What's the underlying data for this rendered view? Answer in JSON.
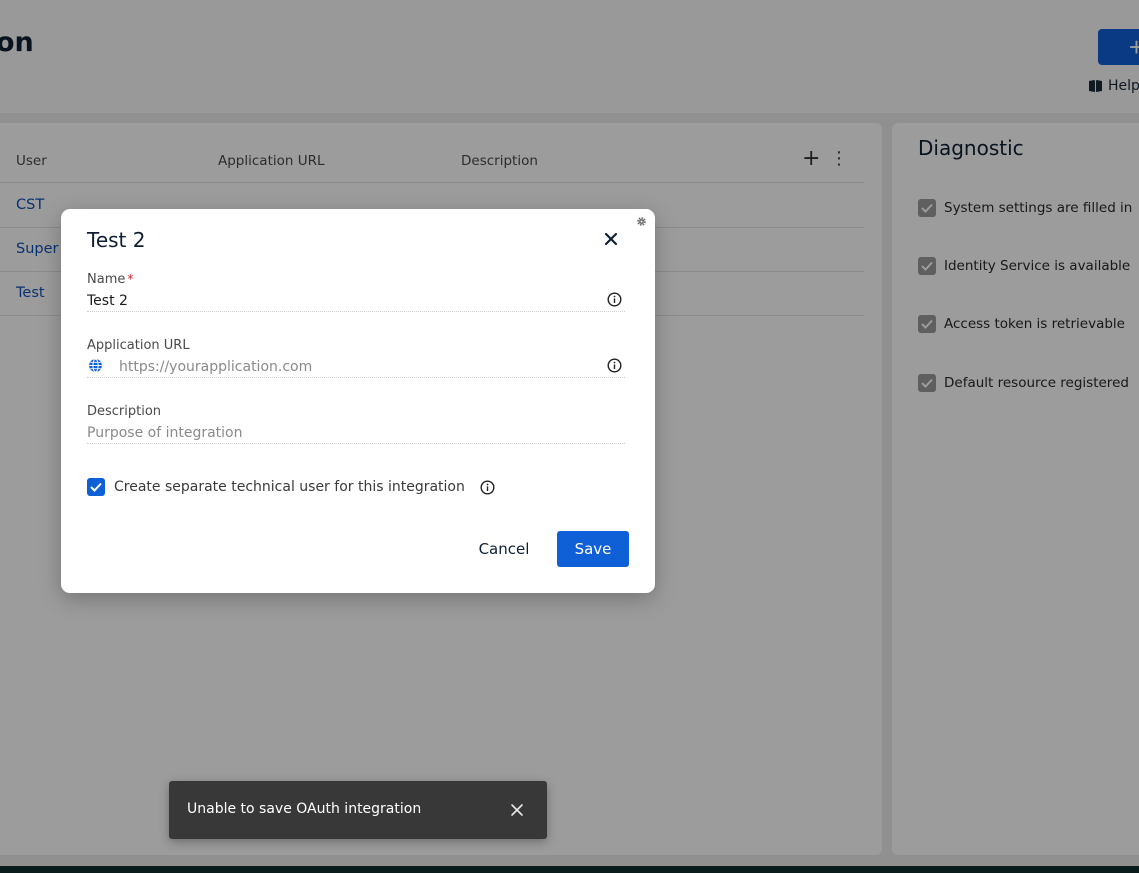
{
  "page": {
    "title": "on",
    "add_label": "+",
    "help_label": "Help"
  },
  "table": {
    "columns": [
      "User",
      "Application URL",
      "Description"
    ],
    "rows": [
      {
        "user": "CST"
      },
      {
        "user": "Super"
      },
      {
        "user": "Test"
      }
    ]
  },
  "diagnostic": {
    "title": "Diagnostic",
    "items": [
      "System settings are filled in",
      "Identity Service is available",
      "Access token is retrievable",
      "Default resource registered"
    ]
  },
  "modal": {
    "title": "Test 2",
    "name_label": "Name",
    "required_mark": "*",
    "name_value": "Test 2",
    "url_label": "Application URL",
    "url_placeholder": "https://yourapplication.com",
    "description_label": "Description",
    "description_placeholder": "Purpose of integration",
    "checkbox_label": "Create separate technical user for this integration",
    "checkbox_checked": true,
    "cancel_label": "Cancel",
    "save_label": "Save"
  },
  "toast": {
    "message": "Unable to save OAuth integration"
  },
  "colors": {
    "primary": "#0f5fd7",
    "link": "#0f52b8",
    "required": "#d8282e",
    "toast_bg": "#383838"
  },
  "icons": [
    "book-icon",
    "plus-icon",
    "more-vertical-icon",
    "gear-icon",
    "close-icon",
    "info-icon",
    "globe-icon",
    "check-icon"
  ]
}
